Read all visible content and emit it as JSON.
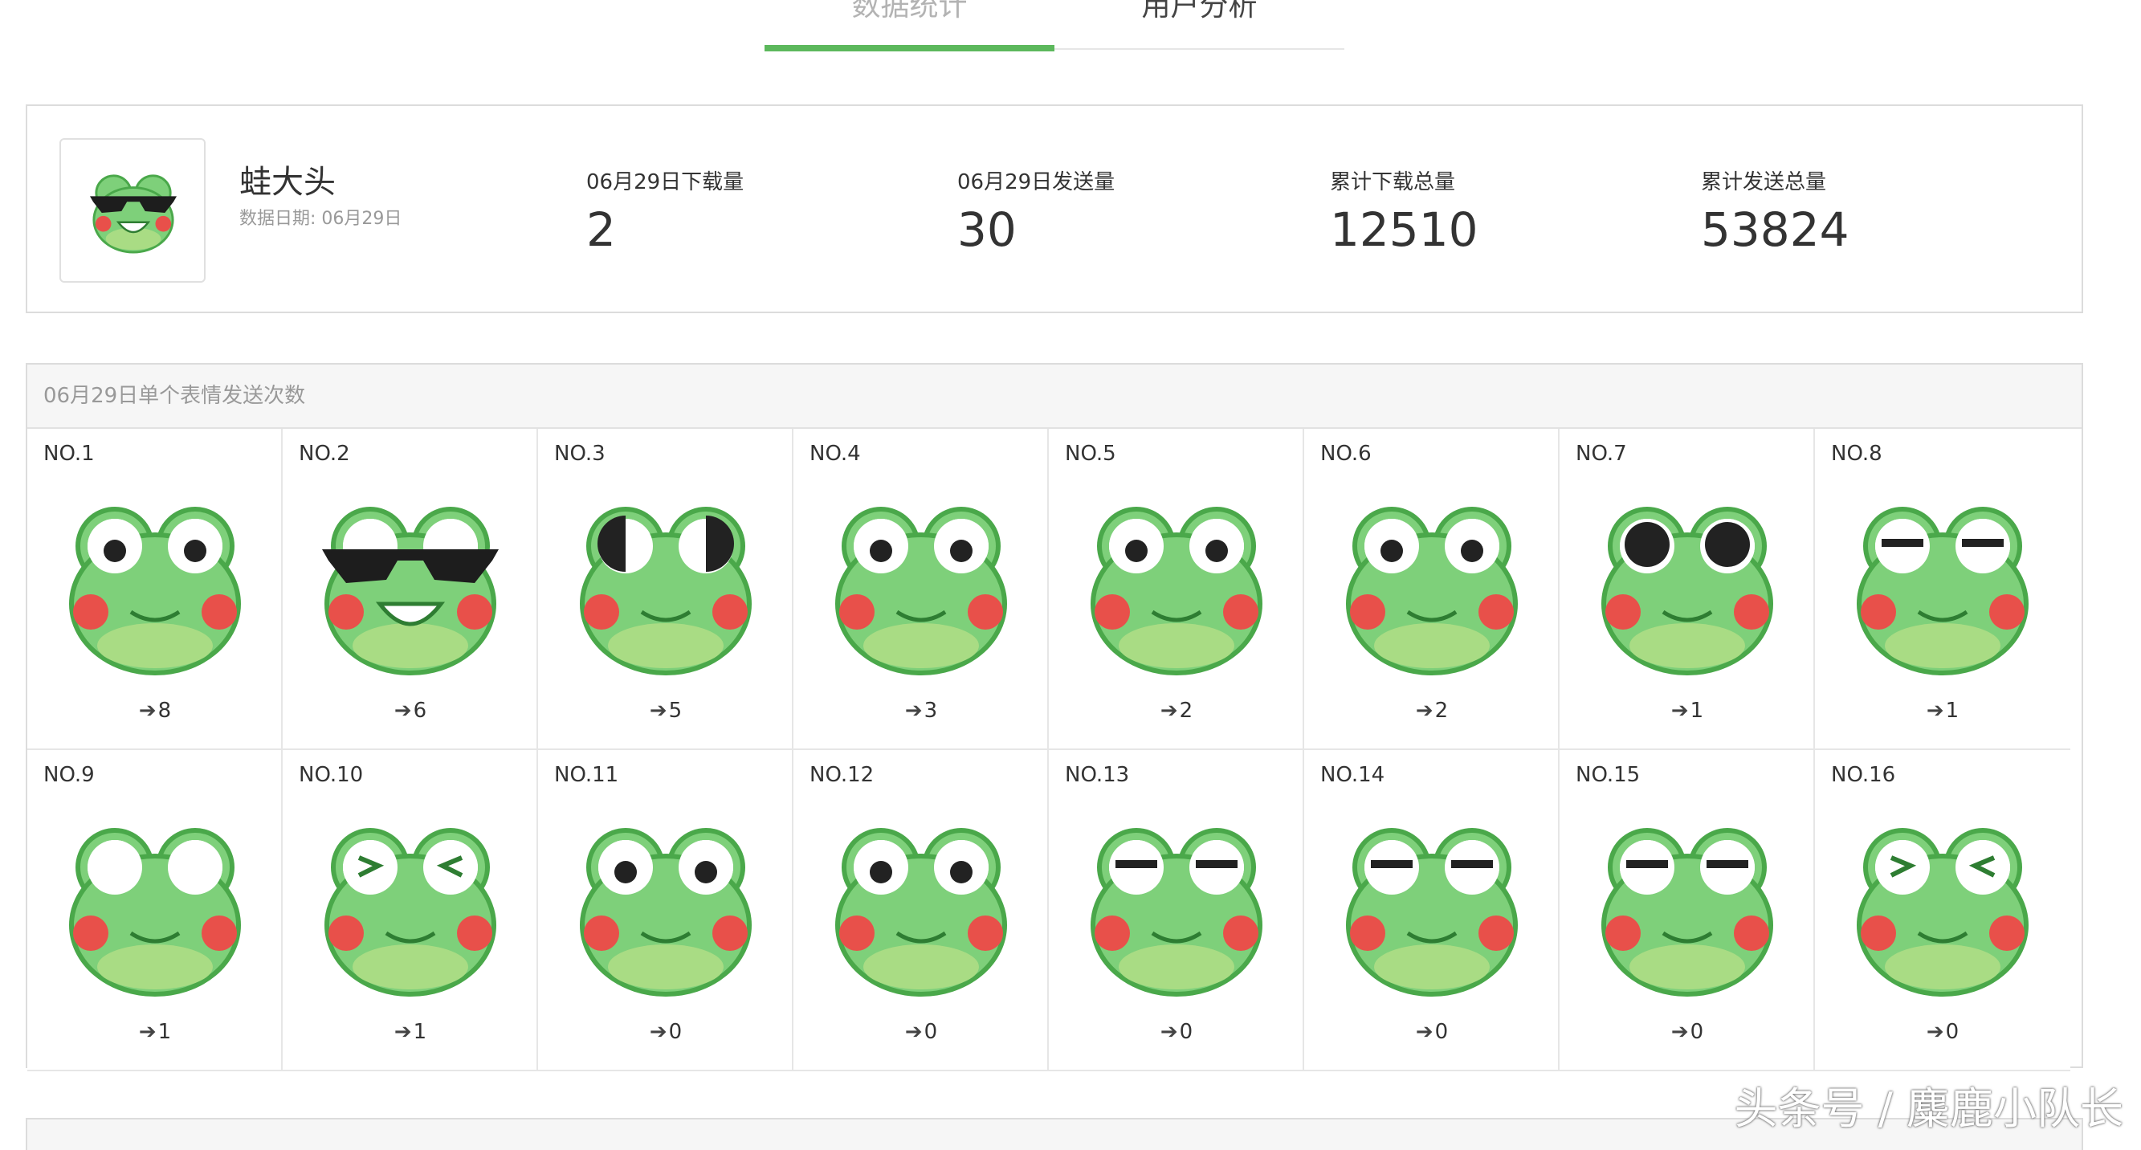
{
  "tabs": [
    {
      "label": "数据统计",
      "active": true
    },
    {
      "label": "用户分析",
      "active": false
    }
  ],
  "accent_color": "#5cb85c",
  "summary": {
    "pack_name": "蛙大头",
    "date_label": "数据日期:",
    "date_value": "06月29日",
    "stats": [
      {
        "label": "06月29日下载量",
        "value": "2"
      },
      {
        "label": "06月29日发送量",
        "value": "30"
      },
      {
        "label": "累计下载总量",
        "value": "12510"
      },
      {
        "label": "累计发送总量",
        "value": "53824"
      }
    ]
  },
  "emoji_panel": {
    "title": "06月29日单个表情发送次数",
    "arrow_glyph": "➔",
    "items": [
      {
        "rank": "NO.1",
        "count": "8",
        "icon": "frog-happy-icon"
      },
      {
        "rank": "NO.2",
        "count": "6",
        "icon": "frog-sunglasses-icon"
      },
      {
        "rank": "NO.3",
        "count": "5",
        "icon": "frog-sideeye-icon"
      },
      {
        "rank": "NO.4",
        "count": "3",
        "icon": "frog-bandaged-icon"
      },
      {
        "rank": "NO.5",
        "count": "2",
        "icon": "frog-sweat-icon"
      },
      {
        "rank": "NO.6",
        "count": "2",
        "icon": "frog-shattered-icon"
      },
      {
        "rank": "NO.7",
        "count": "1",
        "icon": "frog-drinking-icon"
      },
      {
        "rank": "NO.8",
        "count": "1",
        "icon": "frog-smug-icon"
      },
      {
        "rank": "NO.9",
        "count": "1",
        "icon": "frog-speechless-icon"
      },
      {
        "rank": "NO.10",
        "count": "1",
        "icon": "frog-laughing-icon"
      },
      {
        "rank": "NO.11",
        "count": "0",
        "icon": "frog-sparkle-icon"
      },
      {
        "rank": "NO.12",
        "count": "0",
        "icon": "frog-drooling-icon"
      },
      {
        "rank": "NO.13",
        "count": "0",
        "icon": "frog-grimace-icon"
      },
      {
        "rank": "NO.14",
        "count": "0",
        "icon": "frog-unimpressed-icon"
      },
      {
        "rank": "NO.15",
        "count": "0",
        "icon": "frog-meh-icon"
      },
      {
        "rank": "NO.16",
        "count": "0",
        "icon": "frog-dizzy-icon"
      }
    ]
  },
  "watermark": "头条号 / 麋鹿小队长"
}
